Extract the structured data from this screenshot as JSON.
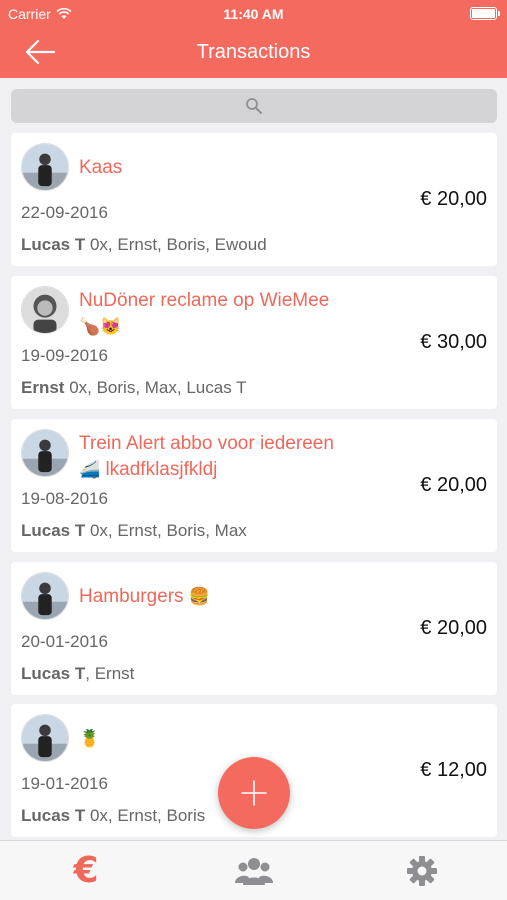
{
  "status_bar": {
    "carrier": "Carrier",
    "time": "11:40 AM"
  },
  "nav": {
    "title": "Transactions"
  },
  "transactions": [
    {
      "title": "Kaas",
      "date": "22-09-2016",
      "payer": "Lucas T",
      "participants": " 0x, Ernst, Boris, Ewoud",
      "amount": "€ 20,00"
    },
    {
      "title": "NuDöner reclame op WieMee",
      "title_emoji": "🍗😻",
      "date": "19-09-2016",
      "payer": "Ernst",
      "participants": " 0x, Boris, Max, Lucas T",
      "amount": "€ 30,00"
    },
    {
      "title": "Trein Alert abbo voor iedereen",
      "title_emoji": "🚄",
      "title_line2": "lkadfklasjfkldj",
      "date": "19-08-2016",
      "payer": "Lucas T",
      "participants": " 0x, Ernst, Boris, Max",
      "amount": "€ 20,00"
    },
    {
      "title": "Hamburgers",
      "title_emoji": "🍔",
      "date": "20-01-2016",
      "payer": "Lucas T",
      "participants": ", Ernst",
      "amount": "€ 20,00"
    },
    {
      "title_emoji": "🍍",
      "date": "19-01-2016",
      "payer": "Lucas T",
      "participants": " 0x, Ernst, Boris",
      "amount": "€ 12,00"
    }
  ],
  "tab_bar": {
    "euro_glyph": "€"
  },
  "colors": {
    "accent": "#f56a5e",
    "title_text": "#f0685a",
    "icon_grey": "#8e8e93"
  },
  "icons": [
    "back-arrow-icon",
    "search-icon",
    "add-icon",
    "euro-icon",
    "group-icon",
    "gear-icon"
  ]
}
